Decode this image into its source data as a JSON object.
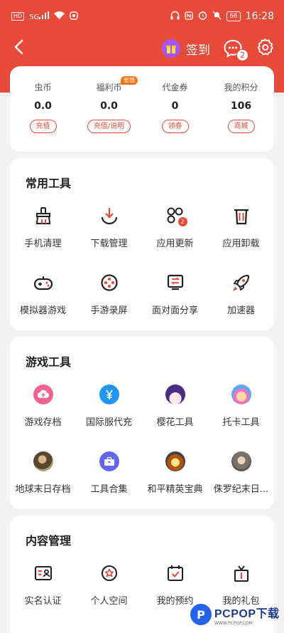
{
  "status_bar": {
    "hd": "HD",
    "signal": "5G",
    "battery": "66",
    "time": "16:28"
  },
  "nav": {
    "checkin_label": "签到",
    "message_badge": "2"
  },
  "wallet": [
    {
      "label": "虫币",
      "value": "0.0",
      "button": "充值"
    },
    {
      "label": "福利币",
      "value": "0.0",
      "button": "充值/说明",
      "tag": "省钱"
    },
    {
      "label": "代金券",
      "value": "0",
      "button": "领券"
    },
    {
      "label": "我的积分",
      "value": "106",
      "button": "商城"
    }
  ],
  "tools": {
    "title": "常用工具",
    "items": [
      {
        "label": "手机清理",
        "icon": "broom-icon"
      },
      {
        "label": "下载管理",
        "icon": "download-icon"
      },
      {
        "label": "应用更新",
        "icon": "apps-update-icon",
        "badge": "2"
      },
      {
        "label": "应用卸载",
        "icon": "trash-icon"
      },
      {
        "label": "模拟器游戏",
        "icon": "gamepad-icon"
      },
      {
        "label": "手游录屏",
        "icon": "film-reel-icon"
      },
      {
        "label": "面对面分享",
        "icon": "share-transfer-icon"
      },
      {
        "label": "加速器",
        "icon": "rocket-icon"
      }
    ]
  },
  "games": {
    "title": "游戏工具",
    "items": [
      {
        "label": "游戏存档",
        "icon": "cloud-upload-icon",
        "color": "#f06292"
      },
      {
        "label": "国际服代充",
        "icon": "yen-icon",
        "color": "#2196f3"
      },
      {
        "label": "樱花工具",
        "icon": "sakura-avatar-icon",
        "color": "#c084fc"
      },
      {
        "label": "托卡工具",
        "icon": "toca-avatar-icon",
        "color": "#60a5fa"
      },
      {
        "label": "地球末日存档",
        "icon": "survivor-avatar-icon",
        "color": "#8d6e4a"
      },
      {
        "label": "工具合集",
        "icon": "toolbox-icon",
        "color": "#6366f1"
      },
      {
        "label": "和平精英宝典",
        "icon": "pubg-avatar-icon",
        "color": "#b45309"
      },
      {
        "label": "侏罗纪末日...",
        "icon": "jurassic-avatar-icon",
        "color": "#78716c"
      }
    ]
  },
  "content": {
    "title": "内容管理",
    "items": [
      {
        "label": "实名认证",
        "icon": "id-card-icon"
      },
      {
        "label": "个人空间",
        "icon": "star-badge-icon"
      },
      {
        "label": "我的预约",
        "icon": "calendar-check-icon"
      },
      {
        "label": "我的礼包",
        "icon": "gift-box-icon"
      }
    ]
  },
  "watermark": {
    "main": "PCPOP下载",
    "sub": "WWW.PCPOP.COM"
  },
  "colors": {
    "brand": "#e84a3a",
    "checkin_circle": "#a855f7"
  }
}
